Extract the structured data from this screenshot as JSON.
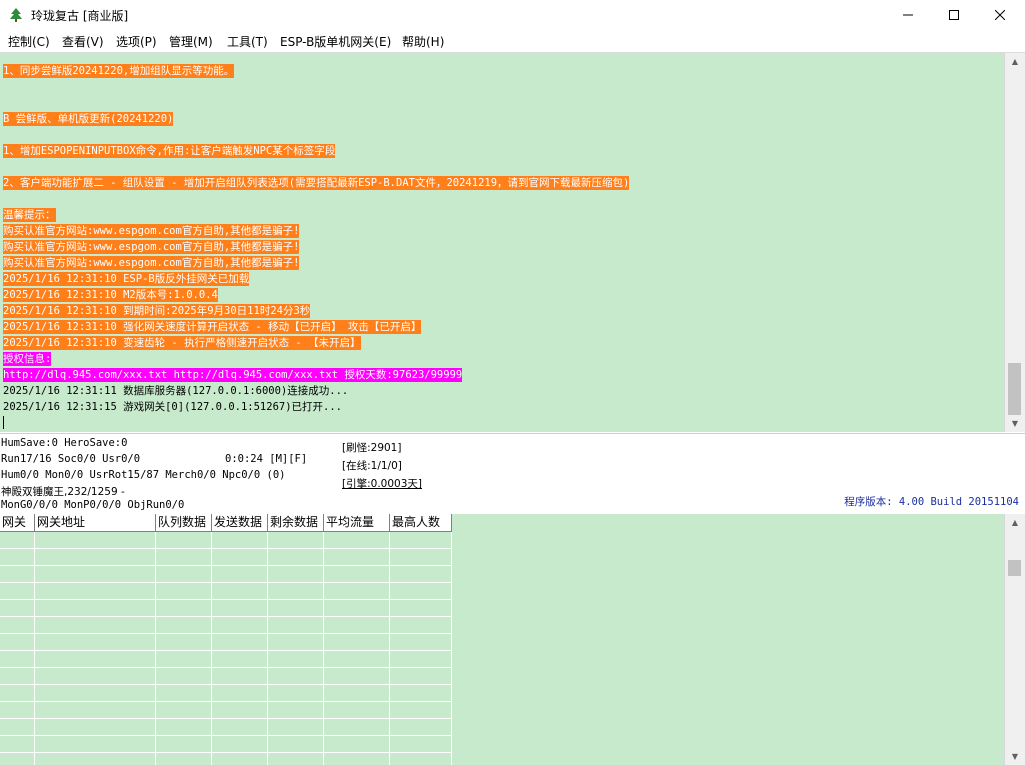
{
  "window": {
    "title": "玲珑复古 [商业版]",
    "controls": {
      "minimize": "—",
      "maximize": "☐",
      "close": "✕"
    }
  },
  "menu": [
    "控制(C)",
    "查看(V)",
    "选项(P)",
    "管理(M)",
    "工具(T)",
    "ESP-B版单机网关(E)",
    "帮助(H)"
  ],
  "log": [
    {
      "text": "1、同步尝鲜版20241220,增加组队显示等功能。",
      "style": "orange"
    },
    {
      "text": "B 尝鲜版、单机版更新(20241220)",
      "style": "orange"
    },
    {
      "text": "1、增加ESPOPENINPUTBOX命令,作用:让客户端触发NPC某个标签字段",
      "style": "orange"
    },
    {
      "text": "2、客户端功能扩展二 - 组队设置 - 增加开启组队列表选项(需要搭配最新ESP-B.DAT文件，20241219，请到官网下载最新压缩包)",
      "style": "orange"
    },
    {
      "text": "温馨提示：",
      "style": "orange"
    },
    {
      "text": "购买认准官方网站:www.espgom.com官方自助,其他都是骗子!",
      "style": "orange"
    },
    {
      "text": "购买认准官方网站:www.espgom.com官方自助,其他都是骗子!",
      "style": "orange"
    },
    {
      "text": "购买认准官方网站:www.espgom.com官方自助,其他都是骗子!",
      "style": "orange"
    },
    {
      "text": "2025/1/16 12:31:10 ESP-B版反外挂网关已加载",
      "style": "orange"
    },
    {
      "text": "2025/1/16 12:31:10 M2版本号:1.0.0.4",
      "style": "orange"
    },
    {
      "text": "2025/1/16 12:31:10 到期时间:2025年9月30日11时24分3秒",
      "style": "orange"
    },
    {
      "text": "2025/1/16 12:31:10 强化网关速度计算开启状态 - 移动【已开启】 攻击【已开启】",
      "style": "orange"
    },
    {
      "text": "2025/1/16 12:31:10 变速齿轮 - 执行严格侧速开启状态 - 【未开启】",
      "style": "orange"
    },
    {
      "text": "授权信息:",
      "style": "magenta"
    },
    {
      "text": "http://dlq.945.com/xxx.txt http://dlq.945.com/xxx.txt 授权天数:97623/99999",
      "style": "magenta"
    },
    {
      "text": "2025/1/16 12:31:11 数据库服务器(127.0.0.1:6000)连接成功...",
      "style": "plain"
    },
    {
      "text": "2025/1/16 12:31:15 游戏网关[0](127.0.0.1:51267)已打开...",
      "style": "plain"
    }
  ],
  "status": {
    "line1": "HumSave:0 HeroSave:0",
    "line2_left": "Run17/16 Soc0/0 Usr0/0",
    "line2_mid": "0:0:24 [M][F]",
    "line3": "Hum0/0 Mon0/0 UsrRot15/87 Merch0/0 Npc0/0 (0)",
    "line4": "神殿双锤魔王,232/1259 -",
    "line5": "MonG0/0/0 MonP0/0/0 ObjRun0/0",
    "refresh": "[刷怪:2901]",
    "online": "[在线:1/1/0]",
    "engine": "[引擎:0.0003天]",
    "version": "程序版本: 4.00 Build 20151104"
  },
  "grid": {
    "columns": [
      "网关",
      "网关地址",
      "队列数据",
      "发送数据",
      "剩余数据",
      "平均流量",
      "最高人数"
    ]
  },
  "colors": {
    "log_bg": "#c7e9cc",
    "orange": "#ff7f1a",
    "magenta": "#ff00ff",
    "version": "#1a2fa0"
  }
}
